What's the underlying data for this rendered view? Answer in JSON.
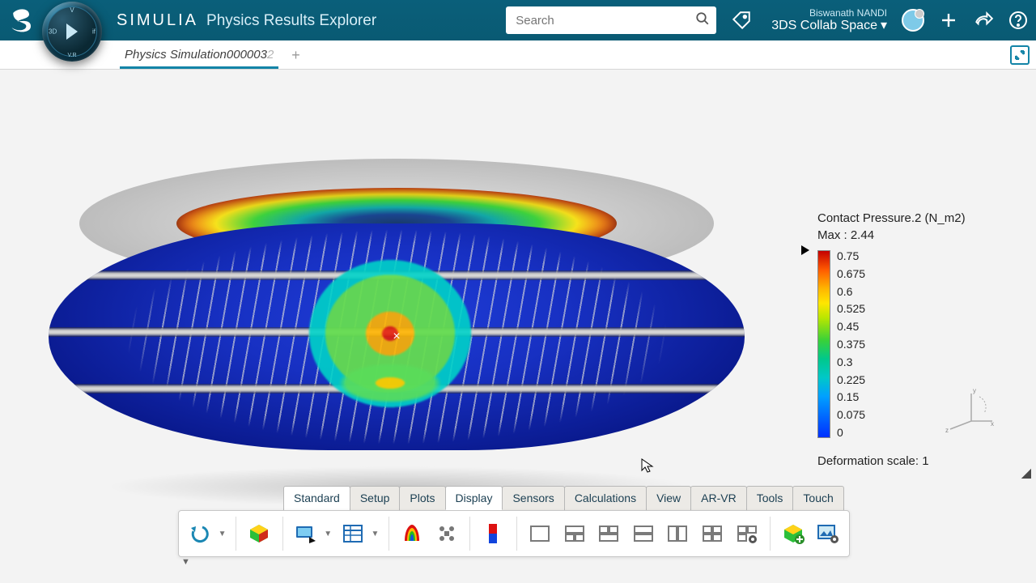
{
  "header": {
    "brand1": "SIMULIA",
    "brand2": "Physics Results Explorer",
    "search_placeholder": "Search",
    "user_name": "Biswanath NANDI",
    "workspace": "3DS Collab Space",
    "compass": {
      "n": "V",
      "s": "V.R",
      "w": "3D",
      "e": "if"
    }
  },
  "document": {
    "tab_name": "Physics Simulation0000032",
    "tab_base": "Physics Simulation000003",
    "tab_suffix": "2"
  },
  "legend": {
    "title": "Contact Pressure.2 (N_m2)",
    "max_label": "Max : 2.44",
    "ticks": [
      "0.75",
      "0.675",
      "0.6",
      "0.525",
      "0.45",
      "0.375",
      "0.3",
      "0.225",
      "0.15",
      "0.075",
      "0"
    ],
    "deformation": "Deformation scale: 1"
  },
  "action_tabs": [
    "Standard",
    "Setup",
    "Plots",
    "Display",
    "Sensors",
    "Calculations",
    "View",
    "AR-VR",
    "Tools",
    "Touch"
  ],
  "active_action_tab": 3,
  "ribbon_tools": {
    "undo": "Undo",
    "model": "Show model",
    "play": "Animate",
    "table": "Results table",
    "contour": "Contour plot",
    "grid": "Color by element",
    "swatch": "Color swatch",
    "layouts": [
      "1x1",
      "split-top",
      "split-bottom",
      "split-h",
      "split-v",
      "quad"
    ],
    "layout_settings": "Layout settings",
    "add_cube": "Create view",
    "image_settings": "Image settings"
  },
  "triad_labels": {
    "x": "x",
    "y": "y",
    "z": "z"
  }
}
